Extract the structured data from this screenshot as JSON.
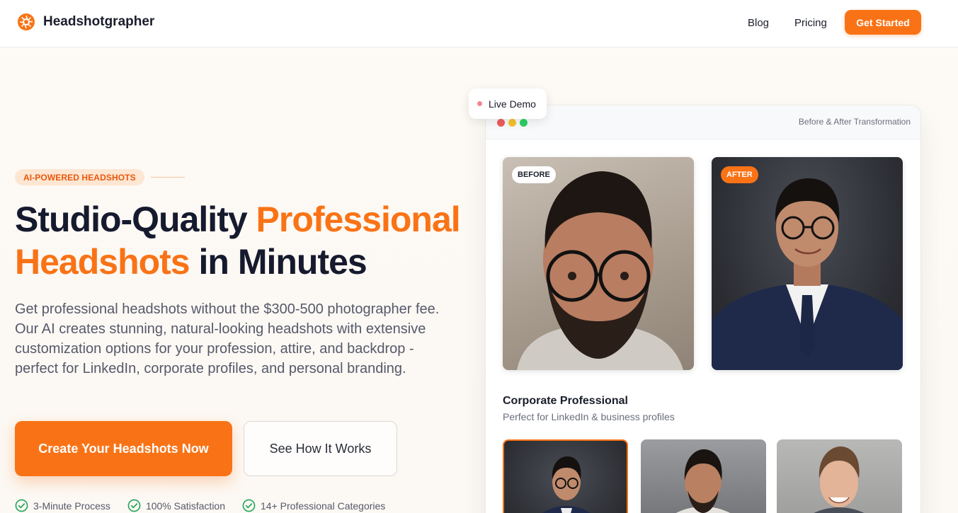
{
  "header": {
    "brand": "Headshotgrapher",
    "nav": {
      "blog": "Blog",
      "pricing": "Pricing",
      "cta": "Get Started"
    }
  },
  "hero": {
    "badge": "AI-POWERED HEADSHOTS",
    "headline_part1": "Studio-Quality ",
    "headline_accent1": "Professional",
    "headline_accent2": "Headshots",
    "headline_part2": " in Minutes",
    "subtext": "Get professional headshots without the $300-500 photographer fee. Our AI creates stunning, natural-looking headshots with extensive customization options for your profession, attire, and backdrop - perfect for LinkedIn, corporate profiles, and personal branding.",
    "primary_cta": "Create Your Headshots Now",
    "secondary_cta": "See How It Works",
    "features": [
      "3-Minute Process",
      "100% Satisfaction",
      "14+ Professional Categories"
    ]
  },
  "demo": {
    "live_label": "Live Demo",
    "window_label": "Before & After Transformation",
    "before_tag": "BEFORE",
    "after_tag": "AFTER",
    "style_title": "Corporate Professional",
    "style_subtitle": "Perfect for LinkedIn & business profiles"
  },
  "colors": {
    "accent": "#f97316",
    "text_dark": "#161a2e",
    "text_muted": "#55596a",
    "check_green": "#22a55b"
  }
}
